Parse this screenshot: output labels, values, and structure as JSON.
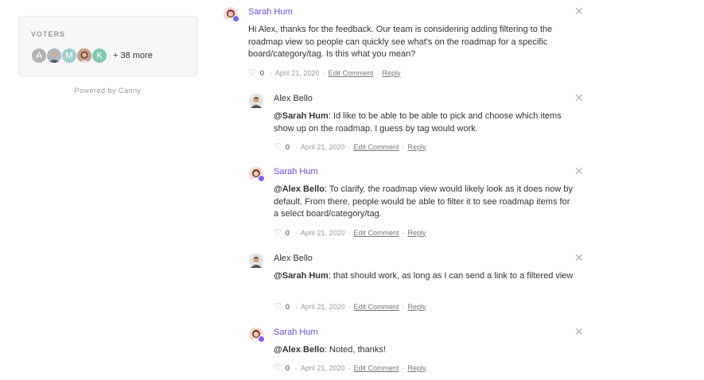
{
  "voters": {
    "title": "VOTERS",
    "avatars": [
      {
        "kind": "letter",
        "letter": "A",
        "color": "#b3b3b3"
      },
      {
        "kind": "photo",
        "icon": "man-avatar"
      },
      {
        "kind": "letter",
        "letter": "M",
        "color": "#9ed0ce"
      },
      {
        "kind": "photo",
        "icon": "woman-avatar"
      },
      {
        "kind": "letter",
        "letter": "K",
        "color": "#7ecbb2"
      }
    ],
    "more": "+ 38 more"
  },
  "powered_by": "Powered by Canny",
  "comments": [
    {
      "author": "Sarah Hum",
      "role": "admin",
      "mention": "",
      "text": "Hi Alex, thanks for the feedback. Our team is considering adding filtering to the roadmap view so people can quickly see what's on the roadmap for a specific board/category/tag. Is this what you mean?",
      "likes": "0",
      "date": "April 21, 2020",
      "edit_label": "Edit Comment",
      "reply_label": "Reply"
    },
    {
      "author": "Alex Bello",
      "role": "user",
      "mention": "@Sarah Hum",
      "text": ": Id like to be able to be able to pick and choose which items show up on the roadmap. I guess by tag would work.",
      "likes": "0",
      "date": "April 21, 2020",
      "edit_label": "Edit Comment",
      "reply_label": "Reply"
    },
    {
      "author": "Sarah Hum",
      "role": "admin",
      "mention": "@Alex Bello",
      "text": ": To clarify, the roadmap view would likely look as it does now by default. From there, people would be able to filter it to see roadmap items for a select board/category/tag.",
      "likes": "0",
      "date": "April 21, 2020",
      "edit_label": "Edit Comment",
      "reply_label": "Reply"
    },
    {
      "author": "Alex Bello",
      "role": "user",
      "mention": "@Sarah Hum",
      "text": ": that should work, as long as I can send a link to a filtered view",
      "likes": "0",
      "date": "April 21, 2020",
      "edit_label": "Edit Comment",
      "reply_label": "Reply"
    },
    {
      "author": "Sarah Hum",
      "role": "admin",
      "mention": "@Alex Bello",
      "text": ": Noted, thanks!",
      "likes": "0",
      "date": "April 21, 2020",
      "edit_label": "Edit Comment",
      "reply_label": "Reply"
    }
  ],
  "icons": {
    "close": "close-icon",
    "like": "heart-icon",
    "admin_badge": "admin-badge-icon"
  },
  "colors": {
    "admin_name": "#6c4be8",
    "badge": "#7b61ff"
  }
}
